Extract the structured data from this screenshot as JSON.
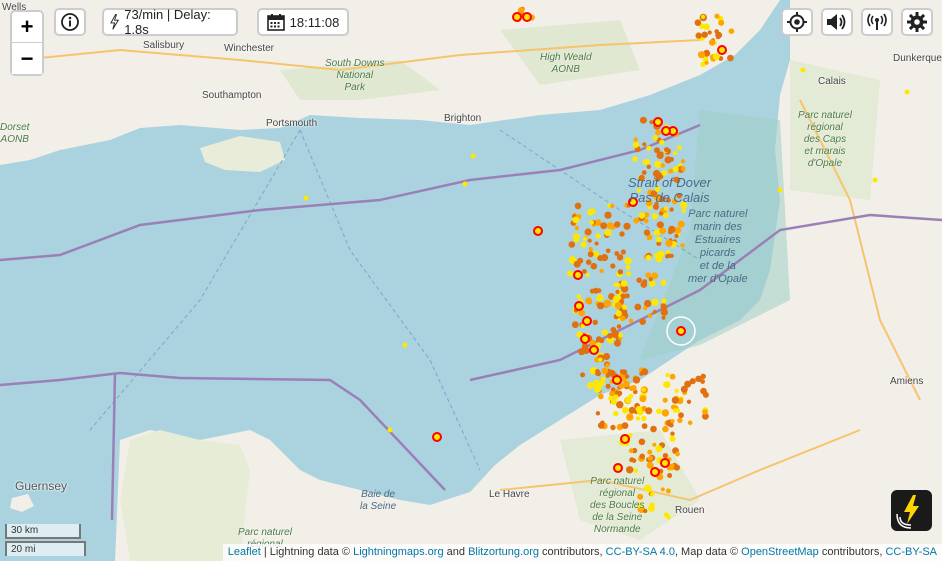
{
  "toolbar": {
    "zoom_in": "+",
    "zoom_out": "−",
    "rate_text": "73/min | Delay: 1.8s",
    "time": "18:11:08"
  },
  "map_labels": {
    "wells": "Wells",
    "salisbury": "Salisbury",
    "winchester": "Winchester",
    "southampton": "Southampton",
    "portsmouth": "Portsmouth",
    "brighton": "Brighton",
    "calais": "Calais",
    "dunkerque": "Dunkerque",
    "le_havre": "Le Havre",
    "amiens": "Amiens",
    "rouen": "Rouen",
    "guernsey": "Guernsey",
    "dorset": "Dorset",
    "dorset_aonb": "AONB",
    "south_downs": "South Downs",
    "south_downs_2": "National",
    "south_downs_3": "Park",
    "high_weald": "High Weald",
    "high_weald_2": "AONB",
    "strait_1": "Strait of Dover",
    "strait_2": "Pas de Calais",
    "parc_marin_1": "Parc naturel",
    "parc_marin_2": "marin des",
    "parc_marin_3": "Estuaires",
    "parc_marin_4": "picards",
    "parc_marin_5": "et de la",
    "parc_marin_6": "mer d'Opale",
    "caps_1": "Parc naturel",
    "caps_2": "régional",
    "caps_3": "des Caps",
    "caps_4": "et marais",
    "caps_5": "d'Opale",
    "seine_bay_1": "Baie de",
    "seine_bay_2": "la Seine",
    "boucles_1": "Parc naturel",
    "boucles_2": "régional",
    "boucles_3": "des Boucles",
    "boucles_4": "de la Seine",
    "boucles_5": "Normande",
    "cotentin_1": "Parc naturel",
    "cotentin_2": "régional"
  },
  "scale": {
    "km": "30 km",
    "mi": "20 mi"
  },
  "attribution": {
    "leaflet": "Leaflet",
    "sep1": " | Lightning data © ",
    "lm": "Lightningmaps.org",
    "and": " and ",
    "bo": "Blitzortung.org",
    "contrib": " contributors, ",
    "cc1": "CC-BY-SA 4.0",
    "mapdata": ", Map data © ",
    "osm": "OpenStreetMap",
    "contrib2": " contributors, ",
    "cc2": "CC-BY-SA"
  },
  "colors": {
    "sea": "#aad3df",
    "land": "#f2efe9",
    "strike_recent": "#ffe800",
    "strike_mid": "#ffa500",
    "strike_old": "#e07010",
    "strike_ring": "#ff0000",
    "border": "#9b80b8"
  },
  "icons": [
    "info-icon",
    "lightning-icon",
    "calendar-icon",
    "locate-icon",
    "sound-icon",
    "signal-icon",
    "gear-icon",
    "blitzortung-logo-icon"
  ]
}
